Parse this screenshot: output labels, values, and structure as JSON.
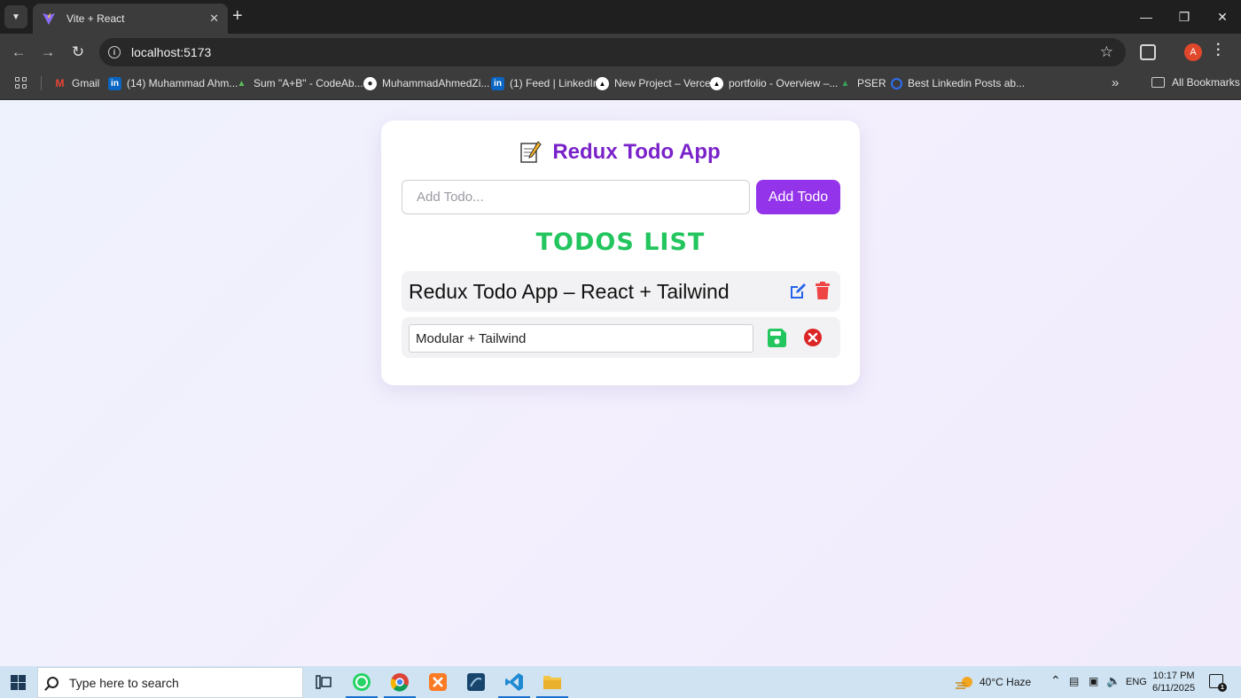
{
  "browser": {
    "tab_title": "Vite + React",
    "url": "localhost:5173",
    "avatar_letter": "A",
    "bookmarks": [
      {
        "label": "Gmail",
        "icon": "gmail-icon"
      },
      {
        "label": "(14) Muhammad Ahm...",
        "icon": "linkedin-icon"
      },
      {
        "label": "Sum \"A+B\" - CodeAb...",
        "icon": "codeabbey-icon"
      },
      {
        "label": "MuhammadAhmedZi...",
        "icon": "github-icon"
      },
      {
        "label": "(1) Feed | LinkedIn",
        "icon": "linkedin-icon"
      },
      {
        "label": "New Project – Vercel",
        "icon": "vercel-icon"
      },
      {
        "label": "portfolio - Overview –...",
        "icon": "vercel-icon"
      },
      {
        "label": "PSER",
        "icon": "pser-icon"
      },
      {
        "label": "Best Linkedin Posts ab...",
        "icon": "globe-icon"
      }
    ],
    "all_bookmarks_label": "All Bookmarks"
  },
  "app": {
    "title": "Redux Todo App",
    "add_placeholder": "Add Todo...",
    "add_button_label": "Add Todo",
    "list_heading": "TODOS LIST",
    "todos": [
      {
        "text": "Redux Todo App – React + Tailwind",
        "editing": false
      },
      {
        "edit_value": "Modular + Tailwind",
        "editing": true
      }
    ],
    "colors": {
      "accent": "#9333ea",
      "title": "#7a22c9",
      "list_heading": "#22c55e",
      "edit_icon": "#2563eb",
      "delete_icon": "#ef4444",
      "save_icon": "#22c55e",
      "cancel_icon": "#dc2626"
    }
  },
  "taskbar": {
    "search_placeholder": "Type here to search",
    "weather": "40°C  Haze",
    "language": "ENG",
    "time": "10:17 PM",
    "date": "6/11/2025",
    "notification_count": "1"
  }
}
